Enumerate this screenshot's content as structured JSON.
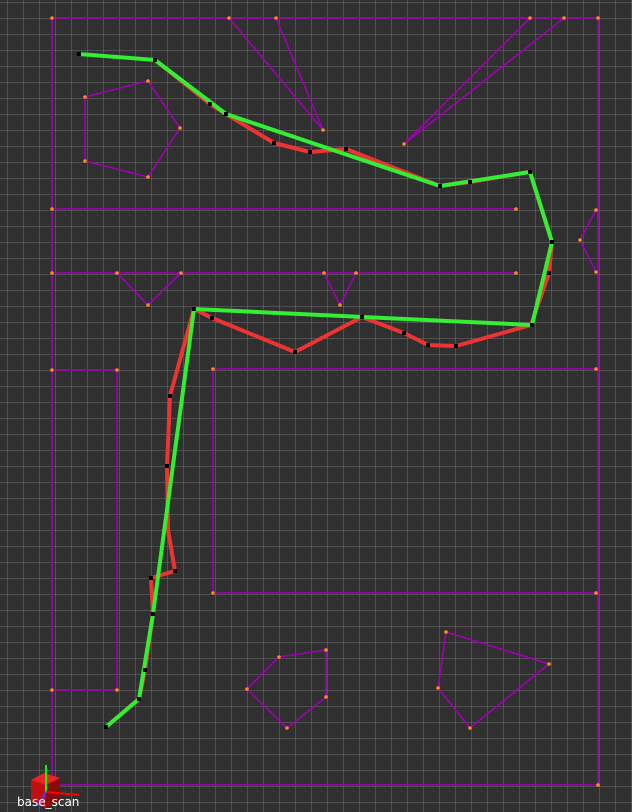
{
  "frame_label": "base_scan",
  "colors": {
    "background": "#303030",
    "grid": "#5a5a5a",
    "obstacles": "#a000b4",
    "vertex_points": "#ff8c1a",
    "reference_path": "#33ee33",
    "planned_path": "#ee3333",
    "waypoints": "#000000",
    "axis_x": "#ff0000",
    "axis_y": "#00ff00",
    "axis_z": "#0000ff",
    "robot_body": "#dd1111"
  },
  "icons": {
    "axes": "tf-axes-icon",
    "robot": "robot-cube-icon"
  }
}
